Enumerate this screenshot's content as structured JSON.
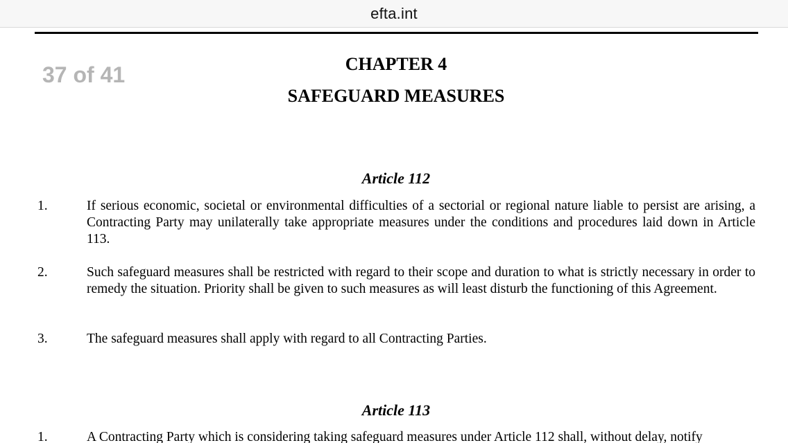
{
  "browser": {
    "address": "efta.int"
  },
  "viewer": {
    "page_counter": "37 of 41"
  },
  "document": {
    "chapter_title": "CHAPTER 4",
    "chapter_subtitle": "SAFEGUARD MEASURES",
    "articles": [
      {
        "heading": "Article 112",
        "paragraphs": [
          {
            "number": "1.",
            "text": "If serious economic, societal or environmental difficulties of a sectorial or regional nature liable to persist are arising, a Contracting Party may unilaterally take appropriate measures under the conditions and procedures laid down in Article 113."
          },
          {
            "number": "2.",
            "text": "Such safeguard measures shall be restricted with regard to their scope and duration to what is strictly necessary in order to remedy the situation.  Priority shall be given to such measures as will least disturb the functioning of this Agreement."
          },
          {
            "number": "3.",
            "text": "The safeguard measures shall apply with regard to all Contracting Parties."
          }
        ]
      },
      {
        "heading": "Article 113",
        "paragraphs": [
          {
            "number": "1.",
            "text": "A Contracting Party which is considering taking safeguard measures under Article 112 shall, without delay, notify"
          }
        ]
      }
    ]
  }
}
